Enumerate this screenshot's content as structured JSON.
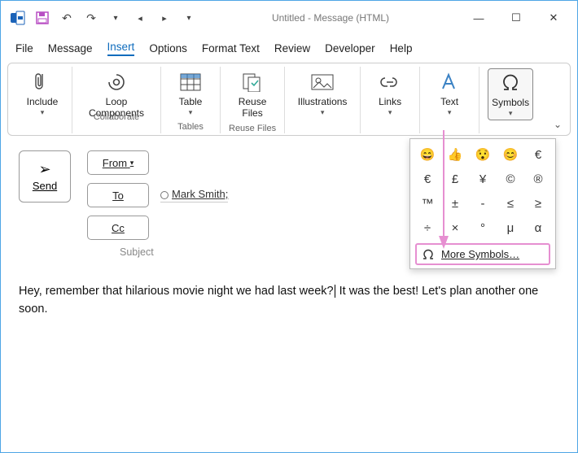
{
  "window": {
    "title": "Untitled  -  Message (HTML)"
  },
  "menu": {
    "file": "File",
    "message": "Message",
    "insert": "Insert",
    "options": "Options",
    "format": "Format Text",
    "review": "Review",
    "developer": "Developer",
    "help": "Help"
  },
  "ribbon": {
    "include": "Include",
    "loop": "Loop\nComponents",
    "table": "Table",
    "reuse": "Reuse\nFiles",
    "illus": "Illustrations",
    "links": "Links",
    "text": "Text",
    "symbols": "Symbols",
    "grp_collab": "Collaborate",
    "grp_tables": "Tables",
    "grp_reuse": "Reuse Files"
  },
  "symgrid": [
    "😄",
    "👍",
    "😯",
    "😊",
    "€",
    "€",
    "£",
    "¥",
    "©",
    "®",
    "™",
    "±",
    "-",
    "≤",
    "≥",
    "÷",
    "×",
    "°",
    "μ",
    "α"
  ],
  "more_symbols": "More Symbols…",
  "compose": {
    "send": "Send",
    "from": "From",
    "to": "To",
    "cc": "Cc",
    "to_value": "Mark Smith;",
    "subject_label": "Subject",
    "body": "Hey, remember that hilarious movie night we had last week? It was the best! Let's plan another one soon."
  }
}
